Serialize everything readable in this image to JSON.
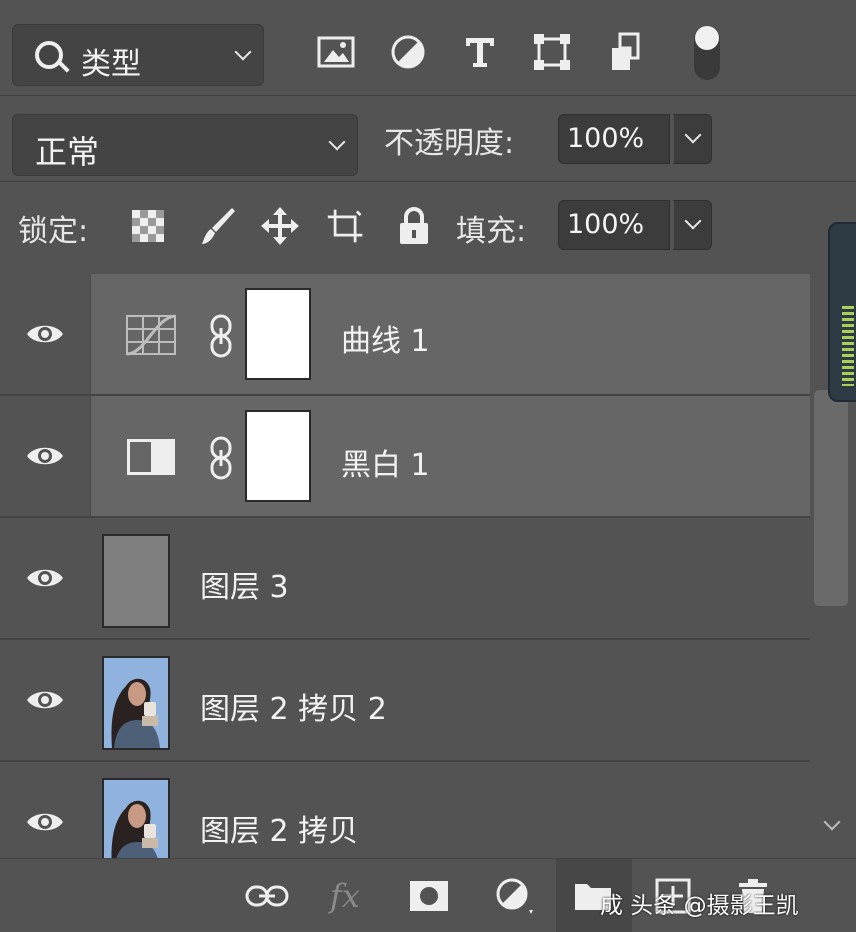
{
  "filter": {
    "label": "类型",
    "icons": [
      "image-filter-icon",
      "adjustment-filter-icon",
      "type-filter-icon",
      "shape-filter-icon",
      "smart-object-filter-icon"
    ]
  },
  "blend": {
    "mode": "正常",
    "opacity_label": "不透明度:",
    "opacity_value": "100%"
  },
  "lock": {
    "label": "锁定:",
    "fill_label": "填充:",
    "fill_value": "100%"
  },
  "layers": [
    {
      "name": "曲线 1",
      "kind": "curves-adjustment",
      "selected": true,
      "visible": true
    },
    {
      "name": "黑白 1",
      "kind": "black-white-adjustment",
      "selected": true,
      "visible": true
    },
    {
      "name": "图层 3",
      "kind": "pixel-gray",
      "selected": false,
      "visible": true
    },
    {
      "name": "图层 2 拷贝 2",
      "kind": "pixel-photo",
      "selected": false,
      "visible": true
    },
    {
      "name": "图层 2 拷贝",
      "kind": "pixel-photo",
      "selected": false,
      "visible": true
    }
  ],
  "footer": {
    "fx_label": "fx"
  },
  "watermark": {
    "text": "成 头条 @摄影王凯"
  },
  "colors": {
    "panel": "#535353",
    "selected_row": "#666666",
    "field": "#3c3c3c"
  }
}
